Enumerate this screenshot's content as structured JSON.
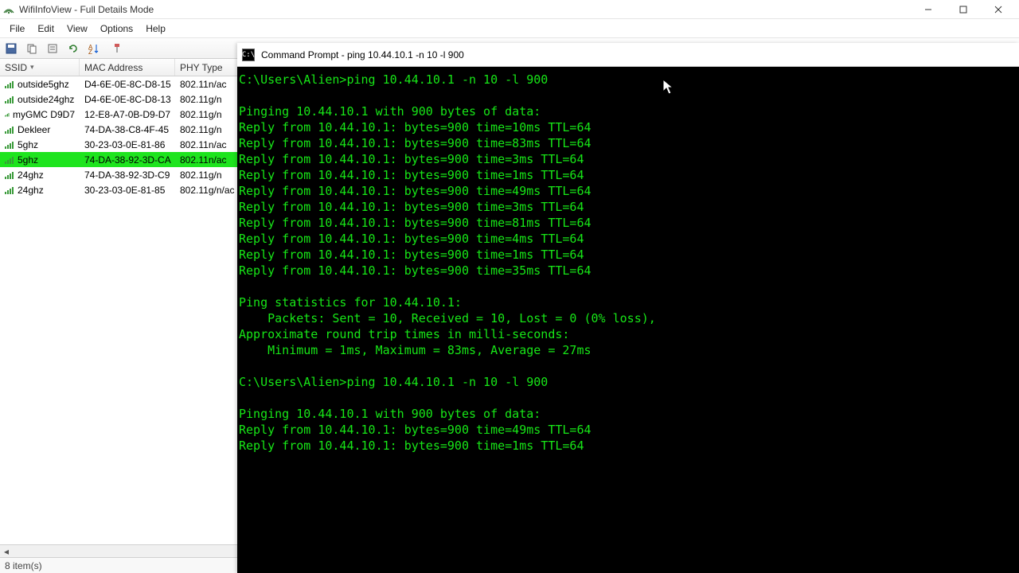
{
  "window": {
    "title": "WifiInfoView   -  Full Details Mode",
    "status": "8 item(s)"
  },
  "menubar": [
    "File",
    "Edit",
    "View",
    "Options",
    "Help"
  ],
  "columns": {
    "ssid": "SSID",
    "mac": "MAC Address",
    "phy": "PHY Type"
  },
  "rows": [
    {
      "ssid": "outside5ghz",
      "mac": "D4-6E-0E-8C-D8-15",
      "phy": "802.11n/ac",
      "selected": false
    },
    {
      "ssid": "outside24ghz",
      "mac": "D4-6E-0E-8C-D8-13",
      "phy": "802.11g/n",
      "selected": false
    },
    {
      "ssid": "myGMC D9D7",
      "mac": "12-E8-A7-0B-D9-D7",
      "phy": "802.11g/n",
      "selected": false
    },
    {
      "ssid": "Dekleer",
      "mac": "74-DA-38-C8-4F-45",
      "phy": "802.11g/n",
      "selected": false
    },
    {
      "ssid": "5ghz",
      "mac": "30-23-03-0E-81-86",
      "phy": "802.11n/ac",
      "selected": false
    },
    {
      "ssid": "5ghz",
      "mac": "74-DA-38-92-3D-CA",
      "phy": "802.11n/ac",
      "selected": true
    },
    {
      "ssid": "24ghz",
      "mac": "74-DA-38-92-3D-C9",
      "phy": "802.11g/n",
      "selected": false
    },
    {
      "ssid": "24ghz",
      "mac": "30-23-03-0E-81-85",
      "phy": "802.11g/n/ac",
      "selected": false
    }
  ],
  "cmd": {
    "title": "Command Prompt - ping  10.44.10.1 -n 10 -l 900",
    "lines": [
      "C:\\Users\\Alien>ping 10.44.10.1 -n 10 -l 900",
      "",
      "Pinging 10.44.10.1 with 900 bytes of data:",
      "Reply from 10.44.10.1: bytes=900 time=10ms TTL=64",
      "Reply from 10.44.10.1: bytes=900 time=83ms TTL=64",
      "Reply from 10.44.10.1: bytes=900 time=3ms TTL=64",
      "Reply from 10.44.10.1: bytes=900 time=1ms TTL=64",
      "Reply from 10.44.10.1: bytes=900 time=49ms TTL=64",
      "Reply from 10.44.10.1: bytes=900 time=3ms TTL=64",
      "Reply from 10.44.10.1: bytes=900 time=81ms TTL=64",
      "Reply from 10.44.10.1: bytes=900 time=4ms TTL=64",
      "Reply from 10.44.10.1: bytes=900 time=1ms TTL=64",
      "Reply from 10.44.10.1: bytes=900 time=35ms TTL=64",
      "",
      "Ping statistics for 10.44.10.1:",
      "    Packets: Sent = 10, Received = 10, Lost = 0 (0% loss),",
      "Approximate round trip times in milli-seconds:",
      "    Minimum = 1ms, Maximum = 83ms, Average = 27ms",
      "",
      "C:\\Users\\Alien>ping 10.44.10.1 -n 10 -l 900",
      "",
      "Pinging 10.44.10.1 with 900 bytes of data:",
      "Reply from 10.44.10.1: bytes=900 time=49ms TTL=64",
      "Reply from 10.44.10.1: bytes=900 time=1ms TTL=64"
    ]
  }
}
